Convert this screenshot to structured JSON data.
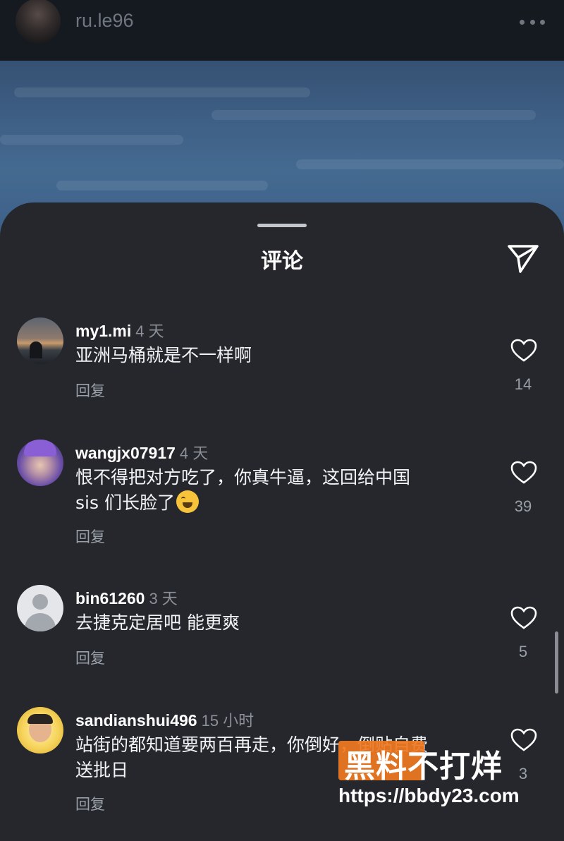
{
  "header": {
    "username": "ru.le96",
    "more_icon": "more-horizontal-icon"
  },
  "sheet": {
    "title": "评论",
    "send_icon": "send-icon"
  },
  "comments": [
    {
      "username": "my1.mi",
      "time": "4 天",
      "text": "亚洲马桶就是不一样啊",
      "reply_label": "回复",
      "likes": "14"
    },
    {
      "username": "wangjx07917",
      "time": "4 天",
      "text_line1": "恨不得把对方吃了，你真牛逼，这回给中国",
      "text_line2": "sis 们长脸了",
      "reply_label": "回复",
      "likes": "39"
    },
    {
      "username": "bin61260",
      "time": "3 天",
      "text": "去捷克定居吧  能更爽",
      "reply_label": "回复",
      "likes": "5"
    },
    {
      "username": "sandianshui496",
      "time": "15 小时",
      "text_line1": "站街的都知道要两百再走，你倒好，倒贴自费",
      "text_line2": "送批日",
      "reply_label": "回复",
      "likes": "3"
    }
  ],
  "watermark": {
    "text": "黑料不打烊",
    "url": "https://bbdy23.com"
  },
  "colors": {
    "sheet_bg": "#25272d",
    "text_primary": "#ffffff",
    "text_secondary": "#9aa0a8",
    "watermark_orange": "#f07a22"
  }
}
